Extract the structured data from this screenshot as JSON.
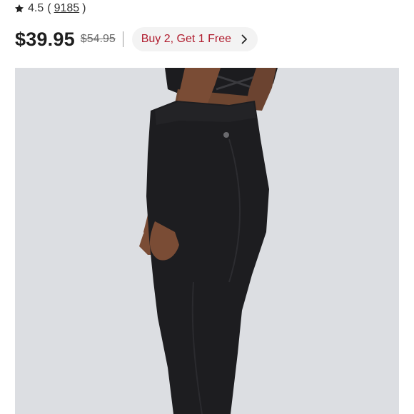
{
  "rating": {
    "icon": "star-icon",
    "value": "4.5",
    "open_paren": "(",
    "review_count": "9185",
    "close_paren": ")"
  },
  "price": {
    "current": "$39.95",
    "original": "$54.95"
  },
  "promo": {
    "label": "Buy 2, Get 1 Free",
    "icon": "chevron-right-icon",
    "text_color": "#b01c2e"
  },
  "product_image": {
    "background": "#dcdee2",
    "subject": "model wearing black high-waisted leggings and black sports bra"
  }
}
